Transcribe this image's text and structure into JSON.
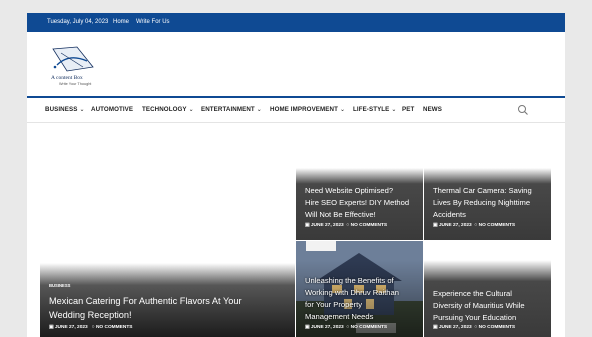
{
  "topbar": {
    "date": "Tuesday, July 04, 2023",
    "links": [
      "Home",
      "Write For Us"
    ]
  },
  "logo": {
    "title": "A content Box",
    "subtitle": "Write Your Thought"
  },
  "nav": {
    "items": [
      {
        "label": "BUSINESS",
        "dropdown": true
      },
      {
        "label": "AUTOMOTIVE",
        "dropdown": false
      },
      {
        "label": "TECHNOLOGY",
        "dropdown": true
      },
      {
        "label": "ENTERTAINMENT",
        "dropdown": true
      },
      {
        "label": "HOME IMPROVEMENT",
        "dropdown": true
      },
      {
        "label": "LIFE-STYLE",
        "dropdown": true
      },
      {
        "label": "PET",
        "dropdown": false
      },
      {
        "label": "NEWS",
        "dropdown": false
      }
    ],
    "search_icon": "search-icon"
  },
  "featured": {
    "category": "BUSINESS",
    "title_lines": [
      "Mexican Catering For Authentic Flavors At Your",
      "Wedding Reception!"
    ],
    "date": "JUNE 27, 2023",
    "comments": "NO COMMENTS"
  },
  "posts": [
    {
      "title_lines": [
        "Need Website Optimised?",
        "Hire SEO Experts! DIY Method",
        "Will Not Be Effective!"
      ],
      "date": "JUNE 27, 2023",
      "comments": "NO COMMENTS"
    },
    {
      "title_lines": [
        "Thermal Car Camera: Saving",
        "Lives By Reducing Nighttime",
        "Accidents"
      ],
      "date": "JUNE 27, 2023",
      "comments": "NO COMMENTS"
    },
    {
      "title_lines": [
        "Unleashing the Benefits of",
        "Working with Dhruv Raithan",
        "for Your Property",
        "Management Needs"
      ],
      "date": "JUNE 27, 2023",
      "comments": "NO COMMENTS"
    },
    {
      "title_lines": [
        "Experience the Cultural",
        "Diversity of Mauritius While",
        "Pursuing Your Education"
      ],
      "date": "JUNE 27, 2023",
      "comments": "NO COMMENTS"
    }
  ],
  "colors": {
    "brand": "#0f4a93",
    "overlay": "#1a1a1a"
  }
}
